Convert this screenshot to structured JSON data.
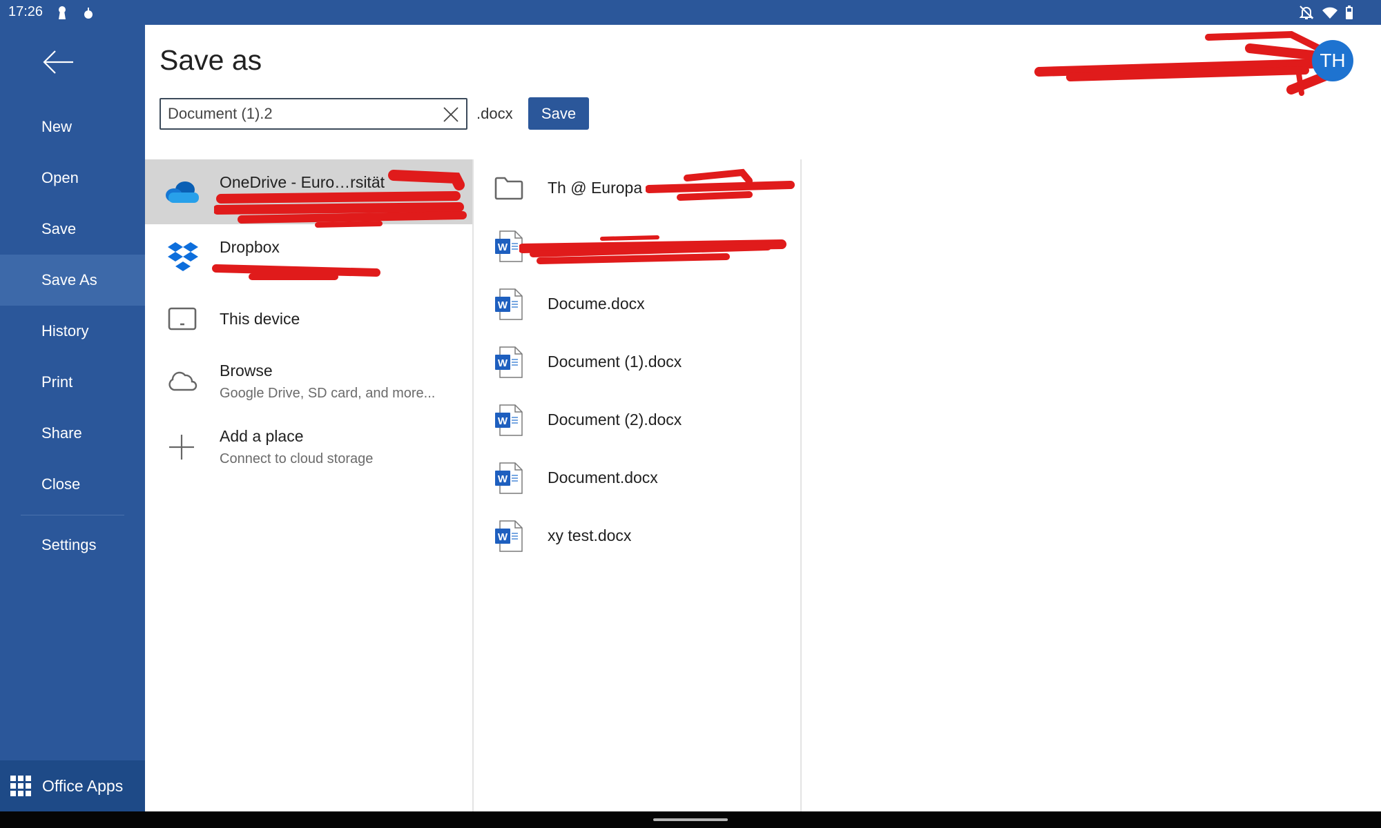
{
  "status_bar": {
    "time": "17:26",
    "left_icons": [
      "keyhole-icon",
      "drop-icon"
    ],
    "right_icons": [
      "notifications-off-icon",
      "wifi-icon",
      "battery-icon"
    ]
  },
  "sidebar": {
    "back_icon": "arrow-left-icon",
    "items": [
      {
        "label": "New"
      },
      {
        "label": "Open"
      },
      {
        "label": "Save"
      },
      {
        "label": "Save As",
        "active": true
      },
      {
        "label": "History"
      },
      {
        "label": "Print"
      },
      {
        "label": "Share"
      },
      {
        "label": "Close"
      },
      {
        "label": "Settings"
      }
    ],
    "office_apps_label": "Office Apps"
  },
  "header": {
    "title": "Save as",
    "filename_value": "Document (1).2",
    "extension": ".docx",
    "save_label": "Save",
    "avatar_initials": "TH"
  },
  "places": [
    {
      "title": "OneDrive - Euro…rsität",
      "subtitle": "",
      "icon": "onedrive-icon",
      "active": true
    },
    {
      "title": "Dropbox",
      "subtitle": "",
      "icon": "dropbox-icon"
    },
    {
      "title": "This device",
      "subtitle": "",
      "icon": "tablet-icon"
    },
    {
      "title": "Browse",
      "subtitle": "Google Drive, SD card, and more...",
      "icon": "cloud-outline-icon"
    },
    {
      "title": "Add a place",
      "subtitle": "Connect to cloud storage",
      "icon": "plus-icon"
    }
  ],
  "files": [
    {
      "name": "Th @ Europa",
      "type": "folder"
    },
    {
      "name": "",
      "type": "docx"
    },
    {
      "name": "Docume.docx",
      "type": "docx"
    },
    {
      "name": "Document (1).docx",
      "type": "docx"
    },
    {
      "name": "Document (2).docx",
      "type": "docx"
    },
    {
      "name": "Document.docx",
      "type": "docx"
    },
    {
      "name": "xy test.docx",
      "type": "docx"
    }
  ],
  "colors": {
    "brand_blue": "#2b579a",
    "active_menu": "#3d69a9",
    "office_apps_bar": "#1e4a87",
    "avatar": "#1e73d0",
    "selected_place": "#d4d4d4",
    "redaction": "#e01b1b"
  }
}
